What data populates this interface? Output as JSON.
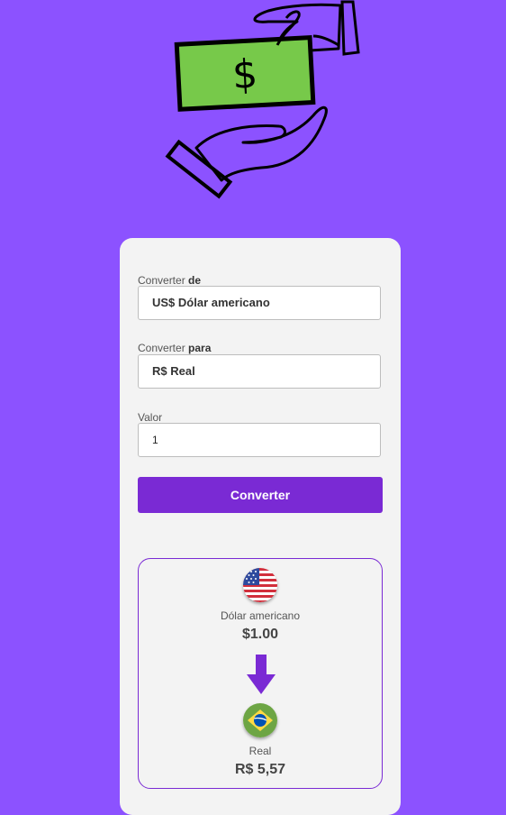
{
  "form": {
    "from_label": "Converter",
    "from_label_bold": "de",
    "from_value": "US$ Dólar americano",
    "to_label": "Converter",
    "to_label_bold": "para",
    "to_value": "R$ Real",
    "amount_label": "Valor",
    "amount_value": "1",
    "button": "Converter"
  },
  "result": {
    "from_name": "Dólar americano",
    "from_amount": "$1.00",
    "to_name": "Real",
    "to_amount": "R$ 5,57"
  },
  "icons": {
    "hero": "money-hand-icon",
    "arrow": "arrow-down-icon",
    "from_flag": "us-flag-icon",
    "to_flag": "brazil-flag-icon"
  },
  "colors": {
    "background": "#8c52ff",
    "accent": "#7a2ad4",
    "banknote": "#77c94a"
  }
}
